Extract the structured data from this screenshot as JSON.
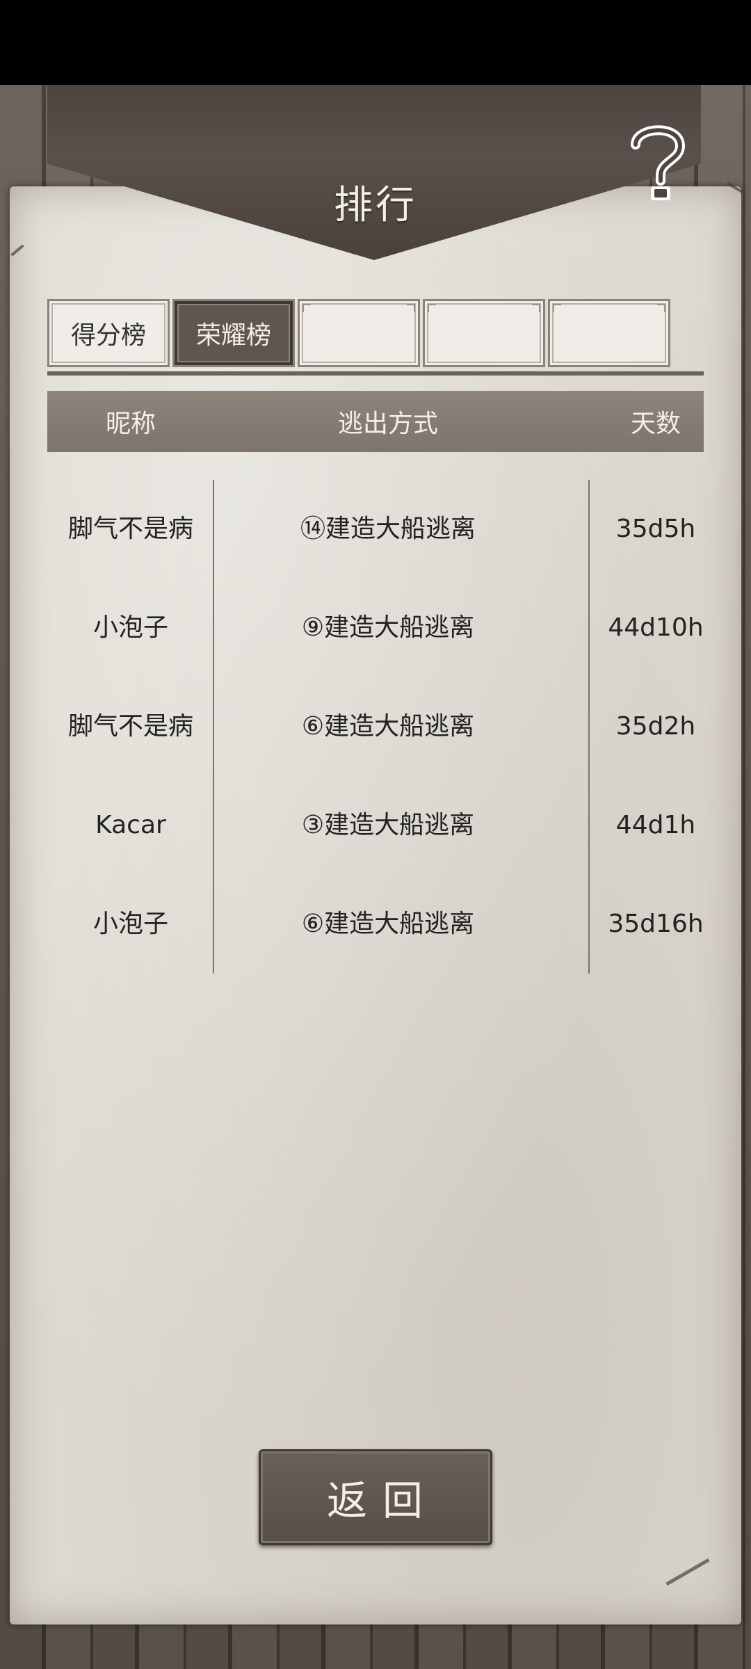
{
  "title": "排行",
  "help_icon": "question-mark-icon",
  "tabs": [
    {
      "label": "得分榜",
      "active": false
    },
    {
      "label": "荣耀榜",
      "active": true
    },
    {
      "label": "",
      "active": false
    },
    {
      "label": "",
      "active": false
    },
    {
      "label": "",
      "active": false
    }
  ],
  "table": {
    "headers": {
      "name": "昵称",
      "method": "逃出方式",
      "days": "天数"
    },
    "rows": [
      {
        "name": "脚气不是病",
        "method": "⑭建造大船逃离",
        "days": "35d5h"
      },
      {
        "name": "小泡子",
        "method": "⑨建造大船逃离",
        "days": "44d10h"
      },
      {
        "name": "脚气不是病",
        "method": "⑥建造大船逃离",
        "days": "35d2h"
      },
      {
        "name": "Kacar",
        "method": "③建造大船逃离",
        "days": "44d1h"
      },
      {
        "name": "小泡子",
        "method": "⑥建造大船逃离",
        "days": "35d16h"
      }
    ]
  },
  "back_button": "返回",
  "colors": {
    "parchment": "#dedad2",
    "banner": "#4d4440",
    "header_bar": "#857d74",
    "active_tab": "#5f5650"
  }
}
